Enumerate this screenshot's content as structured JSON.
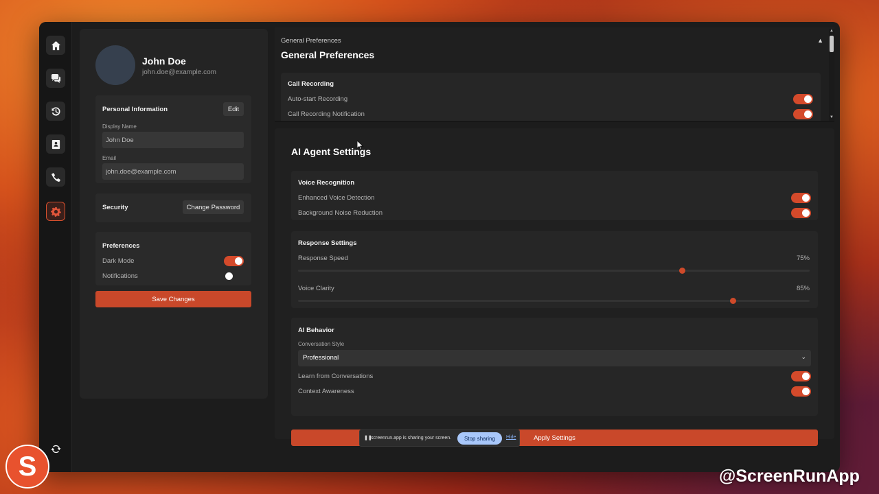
{
  "rail": {
    "items": [
      "home-icon",
      "chat-icon",
      "history-icon",
      "contacts-icon",
      "phone-icon",
      "settings-icon"
    ],
    "active": "settings-icon",
    "bottom_icon": "refresh-icon"
  },
  "profile": {
    "name": "John Doe",
    "email": "john.doe@example.com",
    "personal_info": {
      "title": "Personal Information",
      "edit_label": "Edit",
      "display_name_label": "Display Name",
      "display_name_value": "John Doe",
      "email_label": "Email",
      "email_value": "john.doe@example.com"
    },
    "security": {
      "title": "Security",
      "change_password_label": "Change Password"
    },
    "preferences": {
      "title": "Preferences",
      "dark_mode_label": "Dark Mode",
      "dark_mode_on": true,
      "notifications_label": "Notifications",
      "notifications_on": false
    },
    "save_label": "Save Changes"
  },
  "general": {
    "breadcrumb": "General Preferences",
    "title": "General Preferences",
    "call_recording": {
      "title": "Call Recording",
      "auto_start_label": "Auto-start Recording",
      "notification_label": "Call Recording Notification"
    }
  },
  "ai": {
    "title": "AI Agent Settings",
    "voice": {
      "title": "Voice Recognition",
      "enhanced_label": "Enhanced Voice Detection",
      "noise_label": "Background Noise Reduction"
    },
    "response": {
      "title": "Response Settings",
      "speed_label": "Response Speed",
      "speed_value": "75%",
      "speed_level": 0.75,
      "clarity_label": "Voice Clarity",
      "clarity_value": "85%",
      "clarity_level": 0.85
    },
    "behavior": {
      "title": "AI Behavior",
      "style_label": "Conversation Style",
      "style_value": "Professional",
      "learn_label": "Learn from Conversations",
      "context_label": "Context Awareness"
    },
    "apply_label": "Apply Settings"
  },
  "share_bar": {
    "text": "screenrun.app is sharing your screen.",
    "stop_label": "Stop sharing",
    "hide_label": "Hide"
  },
  "branding": {
    "logo_letter": "S",
    "handle": "@ScreenRunApp"
  },
  "colors": {
    "accent": "#c9482a",
    "panel": "#242424",
    "background": "#1c1c1c"
  }
}
